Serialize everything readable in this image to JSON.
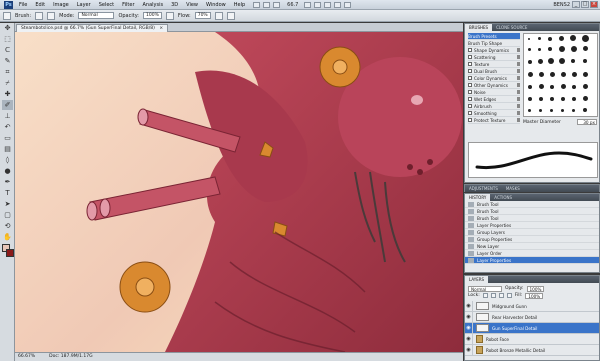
{
  "app": {
    "menu": [
      "File",
      "Edit",
      "Image",
      "Layer",
      "Select",
      "Filter",
      "Analysis",
      "3D",
      "View",
      "Window",
      "Help"
    ],
    "zoom_select": "66.7",
    "workspace": "BENS2"
  },
  "options_bar": {
    "brush_label": "Brush:",
    "mode_label": "Mode:",
    "mode_value": "Normal",
    "opacity_label": "Opacity:",
    "opacity_value": "100%",
    "flow_label": "Flow:",
    "flow_value": "70%"
  },
  "document": {
    "tab_title": "Steambotslice.psd @ 66.7% (Gun SuperFinal Detail, RGB/8)",
    "status_zoom": "66.67%",
    "status_doc": "Doc: 187.9M/1.17G"
  },
  "brushes_panel": {
    "tabs": [
      "BRUSHES",
      "CLONE SOURCE"
    ],
    "options": [
      "Brush Presets",
      "Brush Tip Shape",
      "Shape Dynamics",
      "Scattering",
      "Texture",
      "Dual Brush",
      "Color Dynamics",
      "Other Dynamics",
      "Noise",
      "Wet Edges",
      "Airbrush",
      "Smoothing",
      "Protect Texture"
    ],
    "master_diameter_label": "Master Diameter",
    "master_diameter_value": "30 px"
  },
  "adjust_tabs": [
    "ADJUSTMENTS",
    "MASKS"
  ],
  "history_panel": {
    "tabs": [
      "HISTORY",
      "ACTIONS"
    ],
    "items": [
      "Brush Tool",
      "Brush Tool",
      "Brush Tool",
      "Layer Properties",
      "Group Layers",
      "Group Properties",
      "New Layer",
      "Layer Order",
      "Layer Properties"
    ]
  },
  "layers_panel": {
    "tabs": [
      "LAYERS"
    ],
    "blend_mode": "Normal",
    "opacity_label": "Opacity:",
    "opacity_value": "100%",
    "lock_label": "Lock:",
    "fill_label": "Fill:",
    "fill_value": "100%",
    "layers": [
      "Midground Gunn",
      "Rear Harvester Detail",
      "Gun SuperFinal Detail",
      "Robot Face",
      "Robot Bronze Metallic Detail"
    ]
  },
  "colors": {
    "selection": "#3a74c9",
    "foreground": "#e8c6b8",
    "background": "#8b1a1a"
  }
}
